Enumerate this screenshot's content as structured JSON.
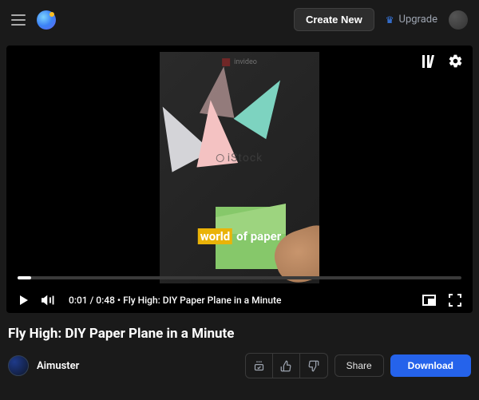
{
  "header": {
    "create_label": "Create New",
    "upgrade_label": "Upgrade"
  },
  "video": {
    "watermark_top": "invideo",
    "watermark_mid": "iStock",
    "caption_highlight": "world",
    "caption_rest": "of paper",
    "time_current": "0:01",
    "time_total": "0:48",
    "separator": " / ",
    "dot_sep": "  •  ",
    "overlay_title": "Fly High: DIY Paper Plane in a Minute"
  },
  "page": {
    "title": "Fly High: DIY Paper Plane in a Minute"
  },
  "author": {
    "name": "Aimuster"
  },
  "actions": {
    "share_label": "Share",
    "download_label": "Download"
  }
}
